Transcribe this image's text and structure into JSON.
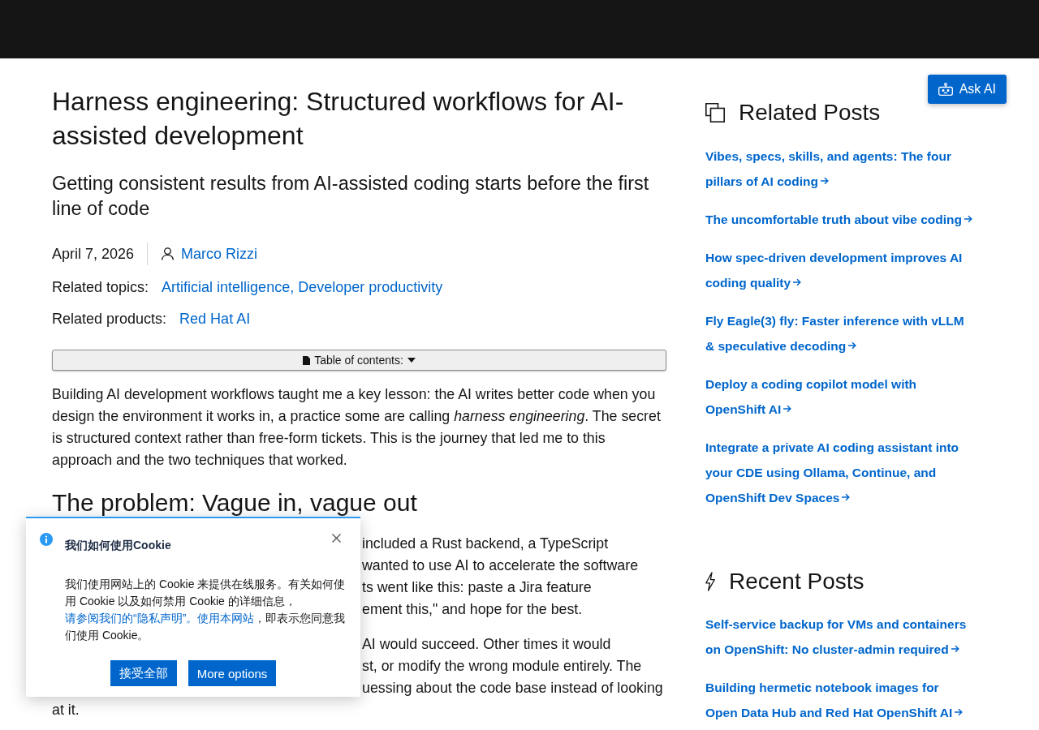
{
  "ask_ai": {
    "label": "Ask AI"
  },
  "article": {
    "title": "Harness engineering: Structured workflows for AI-assisted development",
    "subtitle": "Getting consistent results from AI-assisted coding starts before the first line of code",
    "date": "April 7, 2026",
    "author": "Marco Rizzi",
    "topics": {
      "label": "Related topics:",
      "links": [
        "Artificial intelligence,",
        "Developer productivity"
      ]
    },
    "products": {
      "label": "Related products:",
      "links": [
        "Red Hat AI"
      ]
    },
    "toc": {
      "label": "Table of contents:",
      "expanded": false
    },
    "intro": "Building AI development workflows taught me a key lesson: the AI writes better code when you design the environment it works in, a practice some are calling *harness engineering*. The secret is structured context rather than free-form tickets. This is the journey that led me to this approach and the two techniques that worked.",
    "section_heading": "The problem: Vague in, vague out",
    "covered_paragraphs": [
      {
        "lines": [
          {
            "kind": "covered",
            "text": "included a Rust backend, a TypeScript"
          },
          {
            "kind": "covered",
            "text": "wanted to use AI to accelerate the software"
          },
          {
            "kind": "covered",
            "text": "ts went like this: paste a Jira feature"
          },
          {
            "kind": "covered",
            "text": "ement this,\" and hope for the best."
          }
        ]
      },
      {
        "lines": [
          {
            "kind": "covered",
            "text": "AI would succeed. Other times it would"
          },
          {
            "kind": "covered",
            "text": "st, or modify the wrong module entirely. The"
          },
          {
            "kind": "covered",
            "text": "uessing about the code base instead of looking"
          },
          {
            "kind": "clear",
            "text": "at it."
          }
        ]
      }
    ]
  },
  "sidebar": {
    "sections": [
      {
        "kind": "related",
        "title": "Related Posts",
        "posts": [
          "Vibes, specs, skills, and agents: The four pillars of AI coding",
          "The uncomfortable truth about vibe coding",
          "How spec-driven development improves AI coding quality",
          "Fly Eagle(3) fly: Faster inference with vLLM & speculative decoding",
          "Deploy a coding copilot model with OpenShift AI",
          "Integrate a private AI coding assistant into your CDE using Ollama, Continue, and OpenShift Dev Spaces"
        ]
      },
      {
        "kind": "recent",
        "title": "Recent Posts",
        "posts": [
          "Self-service backup for VMs and containers on OpenShift: No cluster-admin required",
          "Building hermetic notebook images for Open Data Hub and Red Hat OpenShift AI"
        ]
      }
    ]
  },
  "cookie_dialog": {
    "title": "我们如何使用Cookie",
    "body": [
      {
        "kind": "text",
        "text": "我们使用网站上的 Cookie 来提供在线服务。有关如何使用 Cookie 以及如何禁用 Cookie 的详细信息，"
      },
      {
        "kind": "link",
        "text": "请参阅我们的“隐私声明”。"
      },
      {
        "kind": "link",
        "text": "使用本网站"
      },
      {
        "kind": "text",
        "text": "，即表示您同意我们使用 Cookie。"
      }
    ],
    "buttons": [
      "接受全部",
      "More options"
    ]
  }
}
